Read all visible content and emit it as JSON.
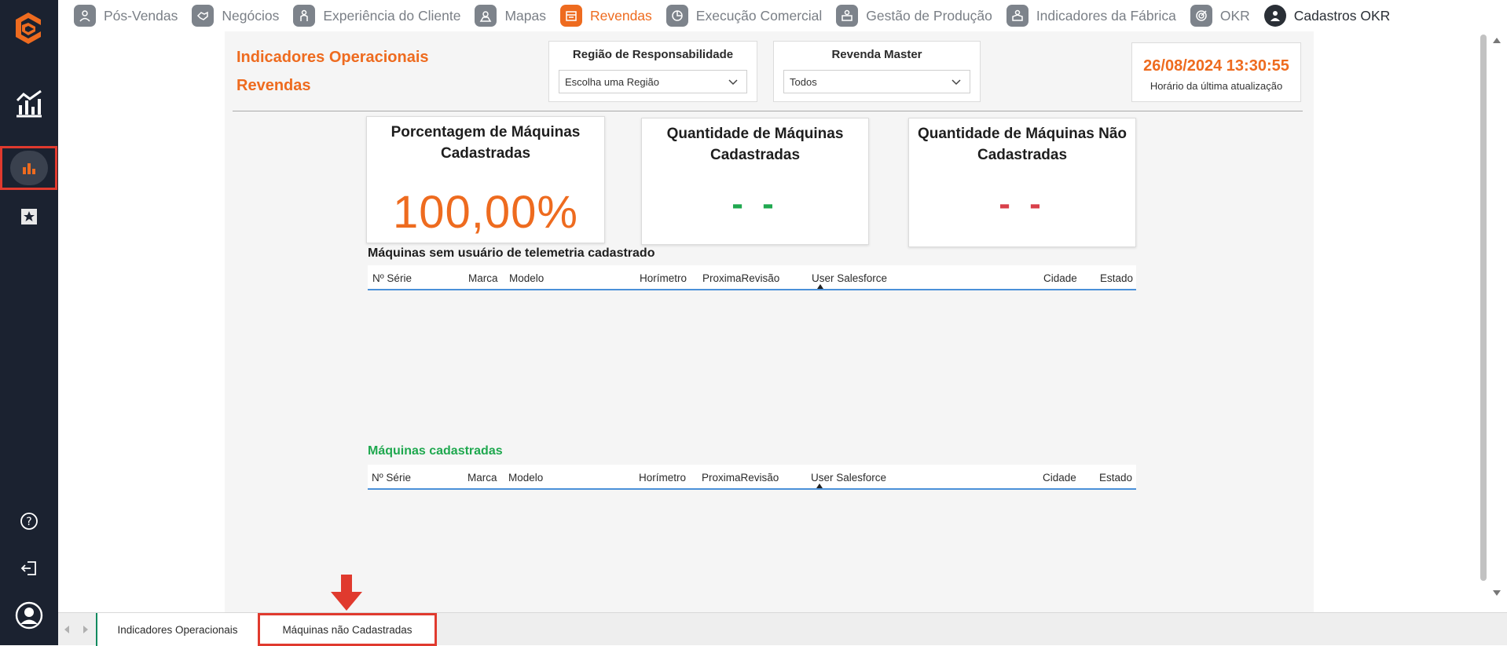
{
  "colors": {
    "accent": "#ee6b1f",
    "sidebar": "#1b2230",
    "green": "#1fa84f",
    "red": "#d9404a",
    "highlight": "#e03a2e"
  },
  "sidebar": {
    "icons": [
      "logo-icon",
      "analytics-chart-icon",
      "bar-chart-icon",
      "star-icon",
      "help-icon",
      "logout-icon",
      "user-avatar-icon"
    ]
  },
  "topnav": {
    "items": [
      {
        "label": "Pós-Vendas",
        "icon": "person-icon"
      },
      {
        "label": "Negócios",
        "icon": "handshake-icon"
      },
      {
        "label": "Experiência do Cliente",
        "icon": "customer-icon"
      },
      {
        "label": "Mapas",
        "icon": "map-icon"
      },
      {
        "label": "Revendas",
        "icon": "store-icon",
        "active": true
      },
      {
        "label": "Execução Comercial",
        "icon": "pie-icon"
      },
      {
        "label": "Gestão de Produção",
        "icon": "factory-icon"
      },
      {
        "label": "Indicadores da Fábrica",
        "icon": "factory-worker-icon"
      },
      {
        "label": "OKR",
        "icon": "target-icon"
      },
      {
        "label": "Cadastros OKR",
        "icon": "user-icon"
      }
    ]
  },
  "header": {
    "title_line1": "Indicadores Operacionais",
    "title_line2": "Revendas",
    "slicer_region_label": "Região de Responsabilidade",
    "slicer_region_value": "Escolha uma Região",
    "slicer_master_label": "Revenda Master",
    "slicer_master_value": "Todos",
    "last_update": "26/08/2024 13:30:55",
    "last_update_label": "Horário da última atualização"
  },
  "cards": {
    "pct_title": "Porcentagem de Máquinas Cadastradas",
    "pct_value": "100,00%",
    "qty_title": "Quantidade de Máquinas Cadastradas",
    "qty_value": "- -",
    "not_title": "Quantidade de Máquinas Não Cadastradas",
    "not_value": "- -"
  },
  "table1": {
    "title": "Máquinas sem usuário de telemetria cadastrado",
    "columns": [
      "Nº Série",
      "Marca",
      "Modelo",
      "Horímetro",
      "ProximaRevisão",
      "User Salesforce",
      "Cidade",
      "Estado"
    ]
  },
  "table2": {
    "title": "Máquinas cadastradas",
    "columns": [
      "Nº Série",
      "Marca",
      "Modelo",
      "Horímetro",
      "ProximaRevisão",
      "User Salesforce",
      "Cidade",
      "Estado"
    ]
  },
  "tabs": {
    "tab1": "Indicadores Operacionais",
    "tab2": "Máquinas não Cadastradas"
  }
}
